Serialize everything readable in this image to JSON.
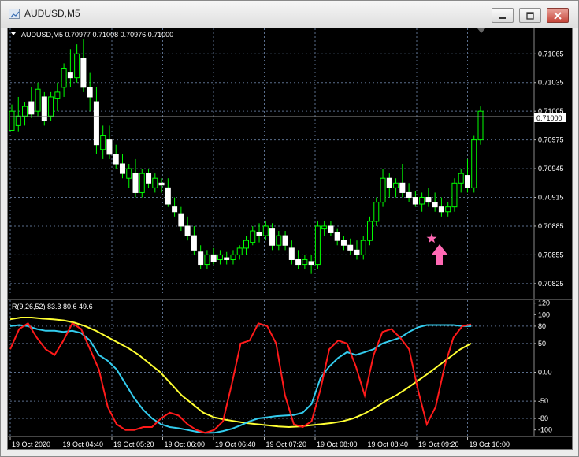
{
  "window": {
    "title": "AUDUSD,M5",
    "controls": [
      "minimize",
      "maximize",
      "close"
    ]
  },
  "main_chart": {
    "header_text": "AUDUSD,M5  0.70977 0.71008 0.70976 0.71000",
    "current_price_label": "0.71000",
    "price_ticks": [
      "0.71065",
      "0.71035",
      "0.71005",
      "0.70975",
      "0.70945",
      "0.70915",
      "0.70885",
      "0.70855",
      "0.70825"
    ],
    "colors": {
      "bull": "#ffffff",
      "wick": "#00ff00",
      "grid": "#5a6e8c",
      "background": "#000000"
    },
    "signal_icons": [
      "star-marker",
      "up-arrow-marker"
    ],
    "signal_color": "#ff69b4"
  },
  "indicator": {
    "header_text": "R(9,26,52) 83.3 80.6 49.6",
    "ticks": [
      "120",
      "100",
      "80",
      "50",
      "0.00",
      "-50",
      "-80",
      "-100"
    ],
    "colors": {
      "fast": "#ff1a1a",
      "mid": "#33ccee",
      "slow": "#ffff33"
    }
  },
  "time_axis": {
    "labels": [
      "19 Oct 2020",
      "19 Oct 04:40",
      "19 Oct 05:20",
      "19 Oct 06:00",
      "19 Oct 06:40",
      "19 Oct 07:20",
      "19 Oct 08:00",
      "19 Oct 08:40",
      "19 Oct 09:20",
      "19 Oct 10:00"
    ]
  },
  "chart_data": [
    {
      "type": "candlestick",
      "title": "AUDUSD,M5",
      "ylim": [
        0.70815,
        0.71085
      ],
      "candles": [
        [
          0.70985,
          0.71012,
          0.7099,
          0.71005
        ],
        [
          0.7099,
          0.7102,
          0.70984,
          0.71
        ],
        [
          0.71,
          0.71015,
          0.7099,
          0.7101
        ],
        [
          0.71015,
          0.7103,
          0.70998,
          0.71002
        ],
        [
          0.71005,
          0.71035,
          0.71,
          0.71028
        ],
        [
          0.7102,
          0.71025,
          0.7099,
          0.70995
        ],
        [
          0.71,
          0.71025,
          0.70995,
          0.7102
        ],
        [
          0.71018,
          0.71035,
          0.71005,
          0.71025
        ],
        [
          0.7103,
          0.71055,
          0.7102,
          0.7105
        ],
        [
          0.71045,
          0.7107,
          0.7103,
          0.7104
        ],
        [
          0.7104,
          0.71075,
          0.71035,
          0.71065
        ],
        [
          0.7106,
          0.7108,
          0.71025,
          0.7103
        ],
        [
          0.7103,
          0.71045,
          0.71005,
          0.7102
        ],
        [
          0.71015,
          0.7103,
          0.7096,
          0.7097
        ],
        [
          0.70965,
          0.7099,
          0.70955,
          0.7098
        ],
        [
          0.70975,
          0.7099,
          0.70955,
          0.7096
        ],
        [
          0.7096,
          0.7097,
          0.70945,
          0.7095
        ],
        [
          0.7095,
          0.7096,
          0.70935,
          0.7094
        ],
        [
          0.70935,
          0.7095,
          0.70925,
          0.70945
        ],
        [
          0.7094,
          0.70955,
          0.70915,
          0.7092
        ],
        [
          0.7092,
          0.70945,
          0.70915,
          0.7094
        ],
        [
          0.7094,
          0.70945,
          0.70925,
          0.7093
        ],
        [
          0.70925,
          0.7094,
          0.7092,
          0.70935
        ],
        [
          0.7093,
          0.70935,
          0.7092,
          0.70928
        ],
        [
          0.70925,
          0.70935,
          0.70905,
          0.70908
        ],
        [
          0.70905,
          0.70915,
          0.70895,
          0.709
        ],
        [
          0.70898,
          0.70905,
          0.7088,
          0.70885
        ],
        [
          0.70885,
          0.70895,
          0.7087,
          0.70875
        ],
        [
          0.70875,
          0.70885,
          0.70855,
          0.7086
        ],
        [
          0.70858,
          0.70865,
          0.7084,
          0.70845
        ],
        [
          0.70845,
          0.7086,
          0.7084,
          0.70855
        ],
        [
          0.70855,
          0.70862,
          0.70845,
          0.70848
        ],
        [
          0.7085,
          0.7086,
          0.70845,
          0.70855
        ],
        [
          0.70852,
          0.70858,
          0.70845,
          0.7085
        ],
        [
          0.7085,
          0.7086,
          0.70845,
          0.70855
        ],
        [
          0.70855,
          0.70865,
          0.7085,
          0.70862
        ],
        [
          0.70862,
          0.70875,
          0.70855,
          0.7087
        ],
        [
          0.70868,
          0.70885,
          0.70865,
          0.7088
        ],
        [
          0.70878,
          0.70888,
          0.70868,
          0.70875
        ],
        [
          0.70875,
          0.7089,
          0.7087,
          0.70885
        ],
        [
          0.70882,
          0.70888,
          0.7086,
          0.70865
        ],
        [
          0.70865,
          0.7088,
          0.7086,
          0.70875
        ],
        [
          0.70875,
          0.7088,
          0.7086,
          0.70865
        ],
        [
          0.70862,
          0.7087,
          0.70845,
          0.7085
        ],
        [
          0.7085,
          0.7086,
          0.7084,
          0.70845
        ],
        [
          0.70845,
          0.70855,
          0.7084,
          0.7085
        ],
        [
          0.70848,
          0.70855,
          0.70835,
          0.70845
        ],
        [
          0.70845,
          0.7089,
          0.7084,
          0.70885
        ],
        [
          0.70882,
          0.7089,
          0.70875,
          0.70885
        ],
        [
          0.70885,
          0.7089,
          0.70875,
          0.70878
        ],
        [
          0.70878,
          0.70882,
          0.70865,
          0.7087
        ],
        [
          0.7087,
          0.70875,
          0.7086,
          0.70865
        ],
        [
          0.70865,
          0.70872,
          0.70855,
          0.7086
        ],
        [
          0.7086,
          0.7087,
          0.7085,
          0.70855
        ],
        [
          0.70855,
          0.70875,
          0.7085,
          0.7087
        ],
        [
          0.7087,
          0.70895,
          0.70865,
          0.7089
        ],
        [
          0.7089,
          0.70915,
          0.70885,
          0.7091
        ],
        [
          0.7091,
          0.70945,
          0.70905,
          0.70935
        ],
        [
          0.70935,
          0.7094,
          0.70915,
          0.70925
        ],
        [
          0.70925,
          0.70935,
          0.70915,
          0.7093
        ],
        [
          0.7093,
          0.7095,
          0.70915,
          0.7092
        ],
        [
          0.7092,
          0.7093,
          0.7091,
          0.70915
        ],
        [
          0.70915,
          0.70922,
          0.70905,
          0.70908
        ],
        [
          0.70908,
          0.7092,
          0.709,
          0.70915
        ],
        [
          0.70915,
          0.70925,
          0.70905,
          0.7091
        ],
        [
          0.7091,
          0.7092,
          0.709,
          0.70905
        ],
        [
          0.70905,
          0.70915,
          0.70895,
          0.709
        ],
        [
          0.709,
          0.7091,
          0.70895,
          0.70905
        ],
        [
          0.70905,
          0.70935,
          0.709,
          0.7093
        ],
        [
          0.7093,
          0.70945,
          0.7092,
          0.7094
        ],
        [
          0.70938,
          0.70955,
          0.7092,
          0.70925
        ],
        [
          0.70925,
          0.7098,
          0.7092,
          0.70975
        ],
        [
          0.70975,
          0.7101,
          0.7097,
          0.71005
        ]
      ]
    },
    {
      "type": "line",
      "title": "R(9,26,52) 83.3 80.6 49.6",
      "ylim": [
        -110,
        125
      ],
      "series": [
        {
          "name": "9",
          "values": [
            40,
            75,
            85,
            60,
            40,
            30,
            55,
            85,
            75,
            40,
            5,
            -60,
            -90,
            -100,
            -100,
            -95,
            -95,
            -80,
            -70,
            -75,
            -90,
            -100,
            -105,
            -100,
            -85,
            -20,
            50,
            55,
            85,
            80,
            50,
            -40,
            -90,
            -95,
            -85,
            -30,
            40,
            55,
            50,
            10,
            -40,
            30,
            70,
            75,
            60,
            40,
            -30,
            -90,
            -60,
            10,
            60,
            80,
            83
          ]
        },
        {
          "name": "26",
          "values": [
            80,
            82,
            80,
            75,
            72,
            72,
            70,
            72,
            68,
            55,
            30,
            20,
            5,
            -20,
            -45,
            -65,
            -80,
            -90,
            -95,
            -97,
            -100,
            -103,
            -105,
            -105,
            -102,
            -98,
            -92,
            -85,
            -80,
            -78,
            -76,
            -75,
            -74,
            -70,
            -55,
            -10,
            10,
            25,
            35,
            30,
            35,
            40,
            50,
            55,
            60,
            70,
            78,
            82,
            82,
            82,
            82,
            80,
            80
          ]
        },
        {
          "name": "52",
          "values": [
            92,
            95,
            95,
            93,
            92,
            90,
            86,
            80,
            72,
            62,
            52,
            42,
            30,
            15,
            0,
            -20,
            -40,
            -55,
            -70,
            -78,
            -82,
            -85,
            -88,
            -90,
            -92,
            -94,
            -95,
            -94,
            -92,
            -90,
            -88,
            -85,
            -80,
            -72,
            -62,
            -50,
            -40,
            -28,
            -15,
            -2,
            12,
            26,
            40,
            50
          ]
        }
      ]
    }
  ]
}
